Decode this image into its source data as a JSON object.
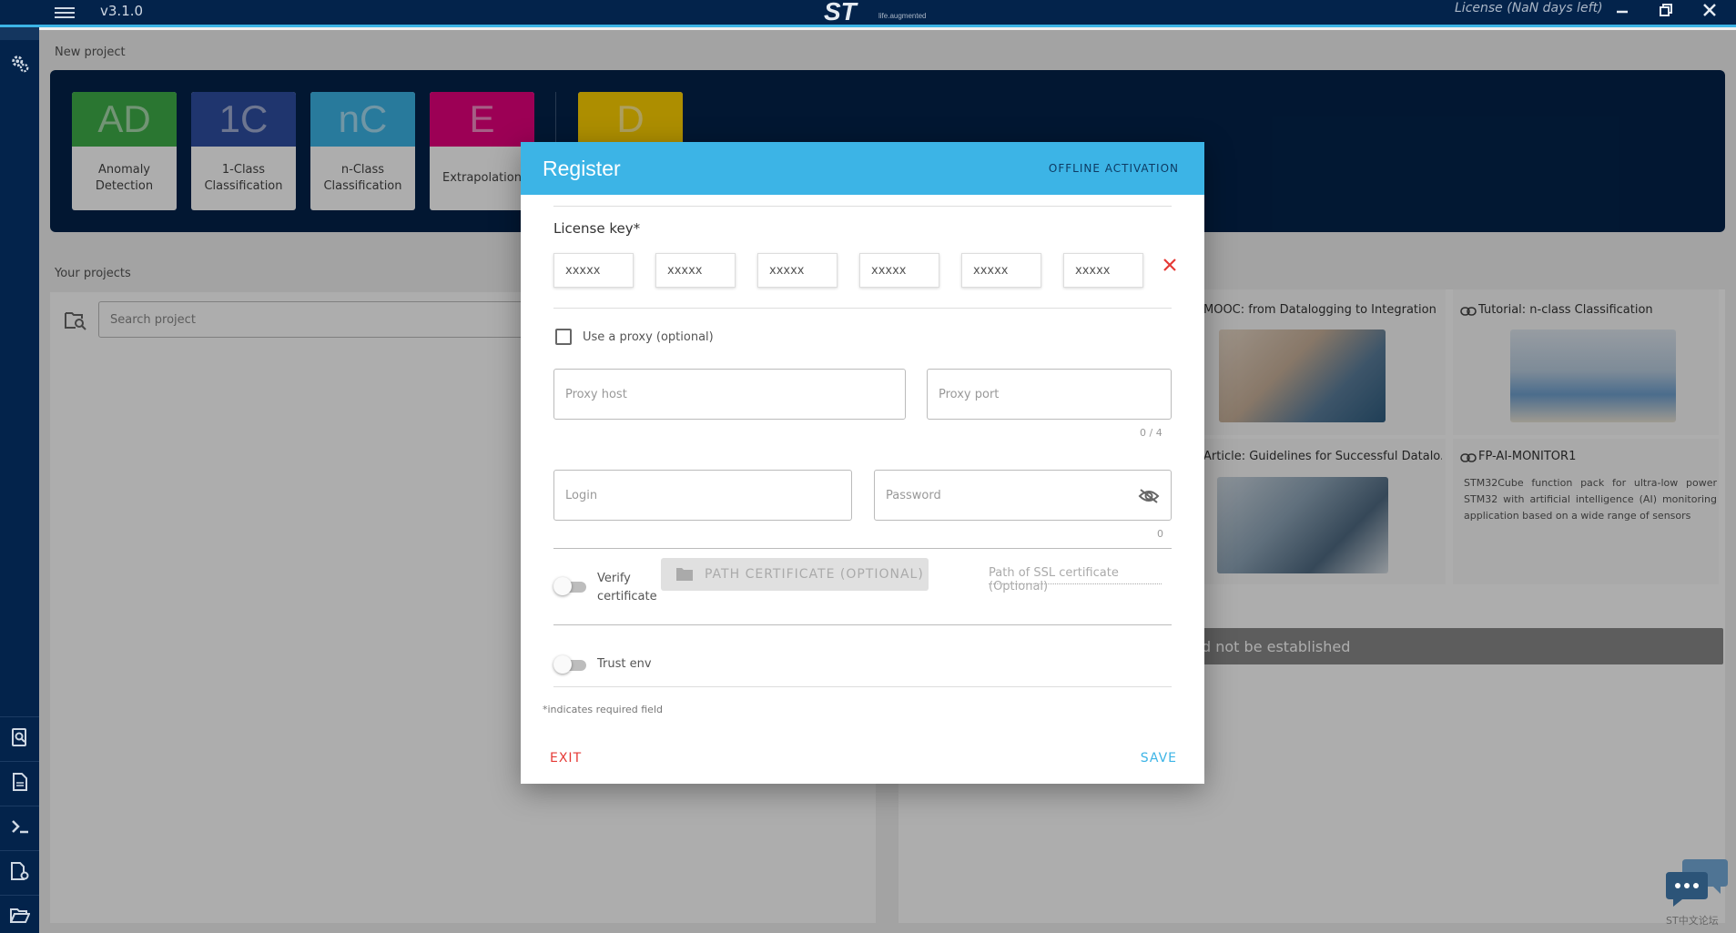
{
  "app": {
    "version": "v3.1.0",
    "logo_text": "ST",
    "tagline": "life.augmented",
    "license_status": "License (NaN days left)"
  },
  "sidebar": {
    "top_items": [
      {
        "icon": "home-icon"
      },
      {
        "icon": "gears-icon"
      }
    ],
    "bottom_items": [
      {
        "icon": "document-search-icon"
      },
      {
        "icon": "document-icon"
      },
      {
        "icon": "terminal-icon"
      },
      {
        "icon": "document-settings-icon"
      },
      {
        "icon": "folder-open-icon"
      }
    ]
  },
  "new_project": {
    "section_label": "New project",
    "tiles": [
      {
        "abbr": "AD",
        "label_line1": "Anomaly",
        "label_line2": "Detection",
        "color": "#3fae49"
      },
      {
        "abbr": "1C",
        "label_line1": "1-Class",
        "label_line2": "Classification",
        "color": "#2f4fa2"
      },
      {
        "abbr": "nC",
        "label_line1": "n-Class",
        "label_line2": "Classification",
        "color": "#3cb4e6"
      },
      {
        "abbr": "E",
        "label_line1": "Extrapolation",
        "label_line2": "",
        "color": "#e6007e"
      },
      {
        "abbr": "D",
        "label_line1": "",
        "label_line2": "",
        "color": "#ffd200"
      }
    ]
  },
  "projects": {
    "section_label": "Your projects",
    "search_placeholder": "Search project"
  },
  "resources": {
    "cards": [
      {
        "title": "MOOC: from Datalogging to Integration"
      },
      {
        "title": "Tutorial: n-class Classification"
      },
      {
        "title": "Article: Guidelines for Successful Datalo..."
      },
      {
        "title": "FP-AI-MONITOR1",
        "description": "STM32Cube function pack for ultra-low power STM32 with artificial intelligence (AI) monitoring application based on a wide range of sensors"
      }
    ],
    "error_text": "d not be established"
  },
  "chat_widget": {
    "caption": "ST中文论坛"
  },
  "dialog": {
    "title": "Register",
    "offline_activation": "OFFLINE ACTIVATION",
    "license_key_label": "License key*",
    "license_key_placeholders": [
      "xxxxx",
      "xxxxx",
      "xxxxx",
      "xxxxx",
      "xxxxx",
      "xxxxx"
    ],
    "proxy_checkbox_label": "Use a proxy (optional)",
    "proxy_host_placeholder": "Proxy host",
    "proxy_port_placeholder": "Proxy port",
    "proxy_port_counter": "0 / 4",
    "login_placeholder": "Login",
    "password_placeholder": "Password",
    "password_counter": "0",
    "verify_certificate_line1": "Verify",
    "verify_certificate_line2": "certificate",
    "path_certificate_button": "PATH CERTIFICATE (OPTIONAL)",
    "ssl_path_placeholder": "Path of SSL certificate (Optional)",
    "trust_env_label": "Trust env",
    "required_note": "*indicates required field",
    "exit_label": "EXIT",
    "save_label": "SAVE"
  },
  "colors": {
    "navy": "#03234b",
    "accent_blue": "#3cb4e6",
    "error_red": "#e53935"
  }
}
